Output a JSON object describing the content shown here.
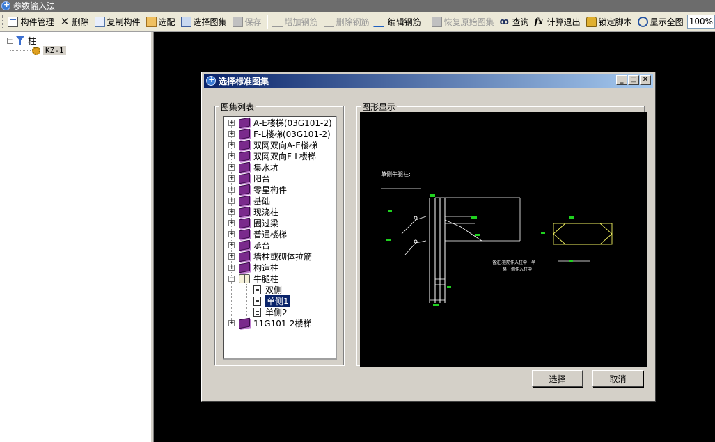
{
  "window": {
    "title": "参数输入法"
  },
  "toolbar": {
    "items": [
      {
        "label": "构件管理",
        "icon": "component-manage-icon",
        "disabled": false
      },
      {
        "label": "删除",
        "icon": "delete-icon",
        "disabled": false
      },
      {
        "label": "复制构件",
        "icon": "copy-component-icon",
        "disabled": false
      },
      {
        "label": "选配",
        "icon": "select-match-icon",
        "disabled": false
      },
      {
        "label": "选择图集",
        "icon": "atlas-icon",
        "disabled": false
      },
      {
        "label": "保存",
        "icon": "save-icon",
        "disabled": true
      },
      {
        "label": "增加钢筋",
        "icon": "add-rebar-icon",
        "disabled": true
      },
      {
        "label": "删除钢筋",
        "icon": "remove-rebar-icon",
        "disabled": true
      },
      {
        "label": "编辑钢筋",
        "icon": "edit-rebar-icon",
        "disabled": false
      },
      {
        "label": "恢复原始图集",
        "icon": "restore-icon",
        "disabled": true
      },
      {
        "label": "查询",
        "icon": "binoculars-icon",
        "disabled": false
      },
      {
        "label": "计算退出",
        "icon": "fx-icon",
        "disabled": false
      },
      {
        "label": "锁定脚本",
        "icon": "lock-icon",
        "disabled": false
      },
      {
        "label": "显示全图",
        "icon": "fit-view-icon",
        "disabled": false
      }
    ],
    "zoom": "100%"
  },
  "left_tree": {
    "root": "柱",
    "child": "KZ-1"
  },
  "dialog": {
    "title": "选择标准图集",
    "list_group_label": "图集列表",
    "preview_group_label": "图形显示",
    "atlas_items": [
      "A-E楼梯(03G101-2)",
      "F-L楼梯(03G101-2)",
      "双网双向A-E楼梯",
      "双网双向F-L楼梯",
      "集水坑",
      "阳台",
      "零星构件",
      "基础",
      "现浇柱",
      "圈过梁",
      "普通楼梯",
      "承台",
      "墙柱或砌体拉筋",
      "构造柱",
      "牛腿柱"
    ],
    "corbel_children": [
      "双侧",
      "单侧1",
      "单侧2"
    ],
    "selected_child": "单侧1",
    "last_item": "11G101-2楼梯",
    "preview_title": "单侧牛腿柱:",
    "preview_note_1": "备注:箍筋伸入柱中一半",
    "preview_note_2": "另一侧伸入柱中",
    "ok_label": "选择",
    "cancel_label": "取消",
    "accent_color": "#0a246a"
  }
}
